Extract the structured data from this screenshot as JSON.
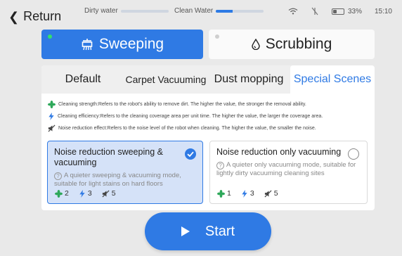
{
  "status": {
    "back_label": "Return",
    "dirty_water_label": "Dirty water",
    "dirty_water_level": 0,
    "clean_water_label": "Clean Water",
    "clean_water_level": 0.35,
    "battery": "33%",
    "time": "15:10"
  },
  "modes": [
    {
      "label": "Sweeping",
      "icon": "sweeper-icon",
      "selected": true
    },
    {
      "label": "Scrubbing",
      "icon": "water-drop-icon",
      "selected": false
    }
  ],
  "tabs": [
    {
      "label": "Default"
    },
    {
      "label": "Carpet Vacuuming"
    },
    {
      "label": "Dust mopping"
    },
    {
      "label": "Special Scenes",
      "active": true
    }
  ],
  "legend": [
    {
      "icon": "fan-icon",
      "text": "Cleaning strength:Refers to the robot's ability to remove dirt. The higher the value, the stronger the removal ability."
    },
    {
      "icon": "lightning-icon",
      "text": "Cleaning efficiency:Refers to the cleaning coverage area per unit time. The higher the value, the larger the coverage area."
    },
    {
      "icon": "mute-icon",
      "text": "Noise reduction effect:Refers to the noise level of the robot when cleaning. The higher the value, the smaller the noise."
    }
  ],
  "options": [
    {
      "title": "Noise reduction sweeping & vacuuming",
      "description": "A quieter sweeping & vacuuming mode, suitable for light stains on hard floors",
      "strength": "2",
      "efficiency": "3",
      "noise": "5",
      "selected": true
    },
    {
      "title": "Noise reduction only vacuuming",
      "description": "A quieter only vacuuming mode, suitable for lightly dirty vacuuming cleaning sites",
      "strength": "1",
      "efficiency": "3",
      "noise": "5",
      "selected": false
    }
  ],
  "start_label": "Start",
  "colors": {
    "accent": "#2f7ae4",
    "fan": "#2ea85a",
    "selected_bg": "#d5e2f8"
  }
}
